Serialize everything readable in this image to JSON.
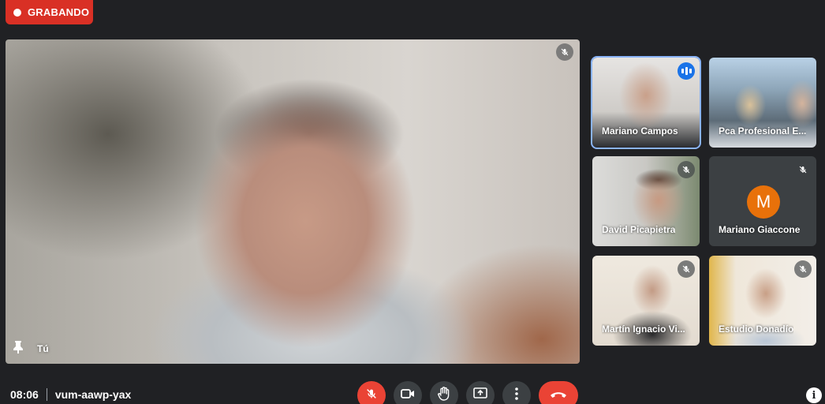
{
  "recording": {
    "label": "GRABANDO",
    "color": "#d93025"
  },
  "main_video": {
    "participant_label": "Tú",
    "pin_icon": "pin-icon",
    "mute_icon": "mic-off-icon"
  },
  "participants": [
    {
      "name": "Mariano Campos",
      "state": "speaking"
    },
    {
      "name": "Pca Profesional E...",
      "state": "none"
    },
    {
      "name": "David Picapietra",
      "state": "muted"
    },
    {
      "name": "Mariano Giaccone",
      "state": "muted",
      "avatar_letter": "M",
      "avatar_color": "#e8710a"
    },
    {
      "name": "Martín Ignacio Vi...",
      "state": "muted"
    },
    {
      "name": "Estudio Donadío",
      "state": "muted"
    }
  ],
  "meeting": {
    "time": "08:06",
    "code": "vum-aawp-yax"
  },
  "controls": {
    "mic": "mic-off-icon",
    "camera": "camera-icon",
    "raise_hand": "hand-icon",
    "present": "present-screen-icon",
    "more": "more-options-icon",
    "hangup": "hangup-icon"
  },
  "info_label": "i"
}
